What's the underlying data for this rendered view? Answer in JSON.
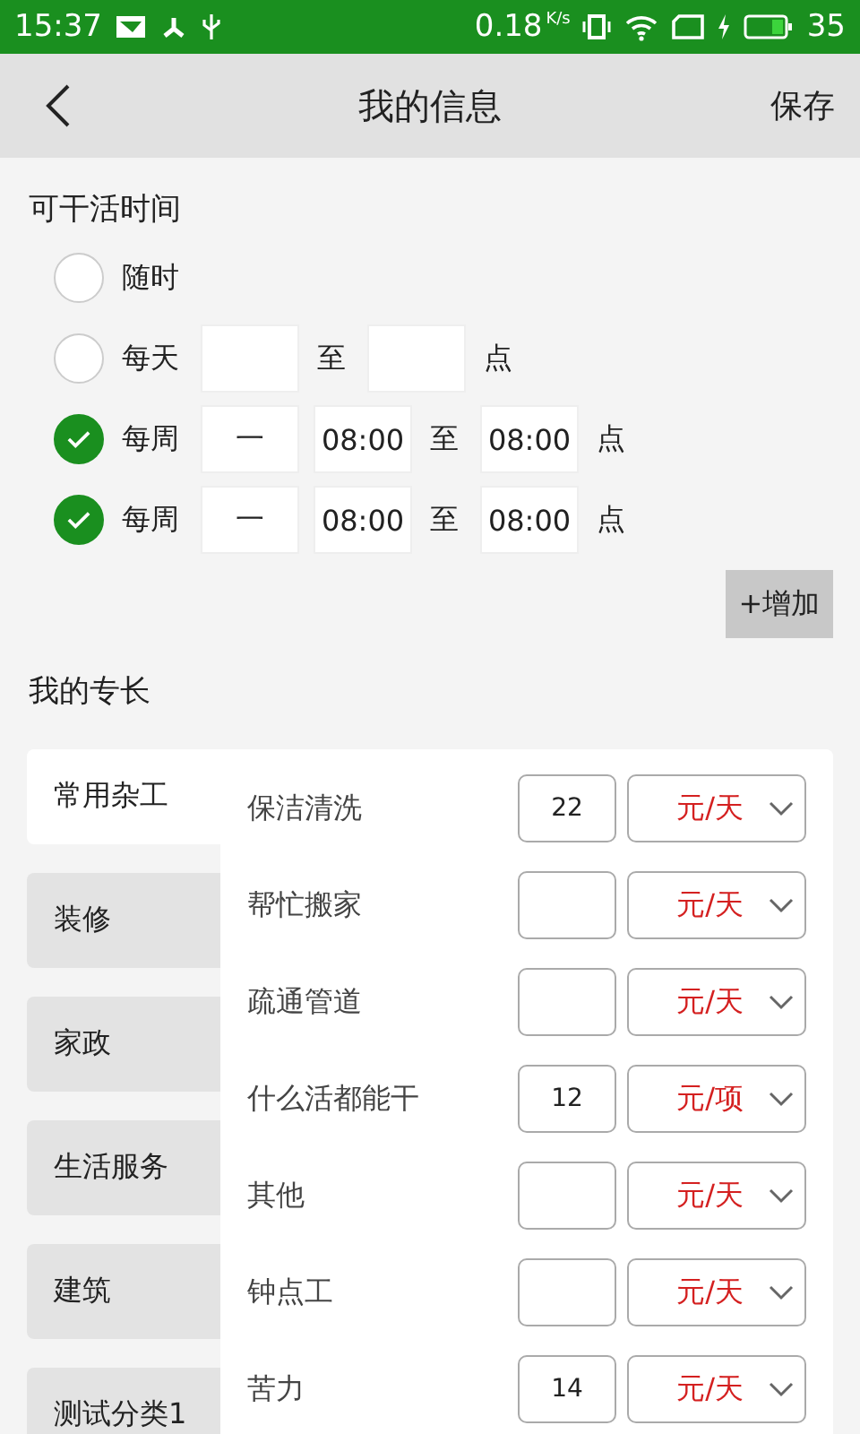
{
  "status_bar": {
    "time": "15:37",
    "speed": "0.18",
    "speed_unit": "K/s",
    "battery": "35"
  },
  "header": {
    "title": "我的信息",
    "action": "保存"
  },
  "schedule": {
    "title": "可干活时间",
    "add_button": "+增加",
    "rows": [
      {
        "kind": "anytime",
        "label": "随时",
        "selected": false
      },
      {
        "kind": "daily",
        "label": "每天",
        "selected": false,
        "separator": "至",
        "suffix": "点"
      },
      {
        "kind": "weekly",
        "label": "每周",
        "selected": true,
        "day": "一",
        "start": "08:00",
        "separator": "至",
        "end": "08:00",
        "suffix": "点"
      },
      {
        "kind": "weekly",
        "label": "每周",
        "selected": true,
        "day": "一",
        "start": "08:00",
        "separator": "至",
        "end": "08:00",
        "suffix": "点"
      }
    ]
  },
  "specialties": {
    "title": "我的专长",
    "categories": [
      {
        "label": "常用杂工",
        "selected": true
      },
      {
        "label": "装修",
        "selected": false
      },
      {
        "label": "家政",
        "selected": false
      },
      {
        "label": "生活服务",
        "selected": false
      },
      {
        "label": "建筑",
        "selected": false
      },
      {
        "label": "测试分类1",
        "selected": false
      }
    ],
    "items": [
      {
        "name": "保洁清洗",
        "price": "22",
        "unit": "元/天"
      },
      {
        "name": "帮忙搬家",
        "unit": "元/天"
      },
      {
        "name": "疏通管道",
        "unit": "元/天"
      },
      {
        "name": "什么活都能干",
        "price": "12",
        "unit": "元/项"
      },
      {
        "name": "其他",
        "unit": "元/天"
      },
      {
        "name": "钟点工",
        "unit": "元/天"
      },
      {
        "name": "苦力",
        "price": "14",
        "unit": "元/天"
      }
    ]
  }
}
